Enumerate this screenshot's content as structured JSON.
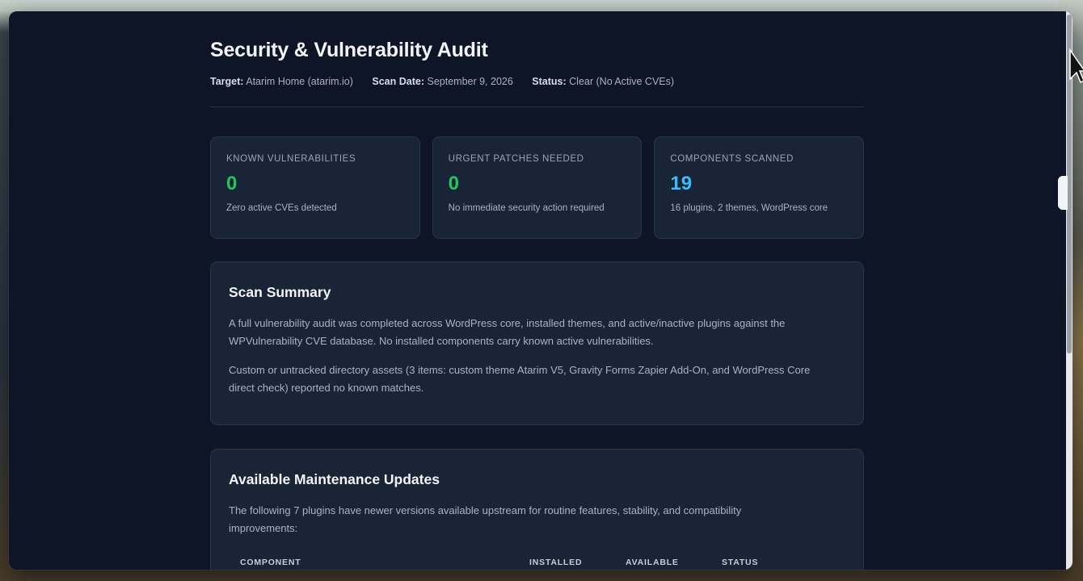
{
  "report": {
    "title": "Security & Vulnerability Audit",
    "meta": {
      "target_label": "Target:",
      "target_value": "Atarim Home (atarim.io)",
      "scan_date_label": "Scan Date:",
      "scan_date_value": "September 9, 2026",
      "status_label": "Status:",
      "status_value": "Clear (No Active CVEs)"
    }
  },
  "stats": [
    {
      "label": "KNOWN VULNERABILITIES",
      "value": "0",
      "desc": "Zero active CVEs detected",
      "color": "#22c55e"
    },
    {
      "label": "URGENT PATCHES NEEDED",
      "value": "0",
      "desc": "No immediate security action required",
      "color": "#22c55e"
    },
    {
      "label": "COMPONENTS SCANNED",
      "value": "19",
      "desc": "16 plugins, 2 themes, WordPress core",
      "color": "#38bdf8"
    }
  ],
  "summary": {
    "heading": "Scan Summary",
    "p1": "A full vulnerability audit was completed across WordPress core, installed themes, and active/inactive plugins against the WPVulnerability CVE database. No installed components carry known active vulnerabilities.",
    "p2": "Custom or untracked directory assets (3 items: custom theme Atarim V5, Gravity Forms Zapier Add-On, and WordPress Core direct check) reported no known matches."
  },
  "updates": {
    "heading": "Available Maintenance Updates",
    "intro": "The following 7 plugins have newer versions available upstream for routine features, stability, and compatibility improvements:",
    "columns": [
      "COMPONENT",
      "INSTALLED",
      "AVAILABLE",
      "STATUS"
    ]
  },
  "colors": {
    "background": "#0d1526",
    "card": "#1a2437",
    "accent_green": "#22c55e",
    "accent_blue": "#38bdf8"
  }
}
